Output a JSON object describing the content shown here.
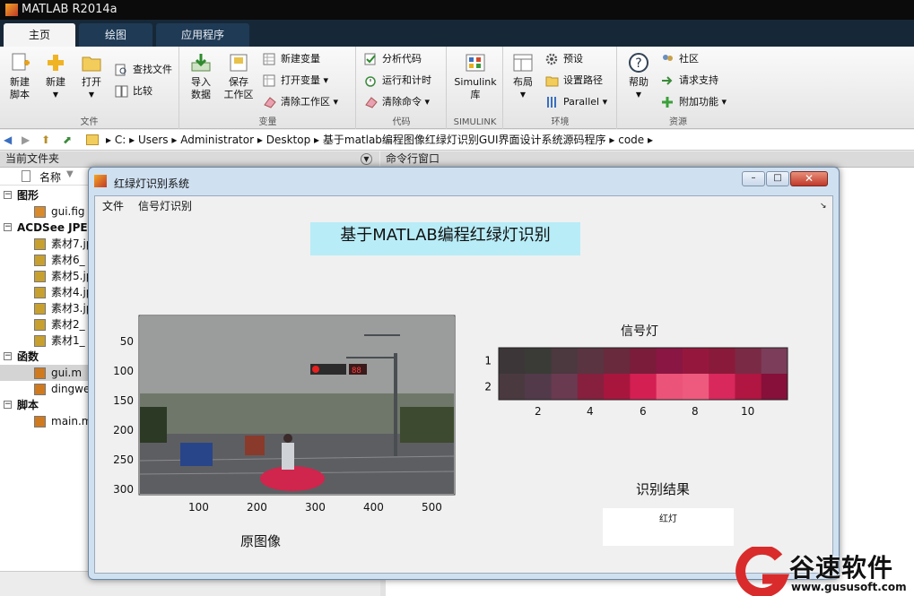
{
  "app": {
    "title": "MATLAB R2014a"
  },
  "tabs": [
    "主页",
    "绘图",
    "应用程序"
  ],
  "ribbon": {
    "file": {
      "label": "文件",
      "new_script": "新建\n脚本",
      "new": "新建",
      "open": "打开",
      "find_files": "查找文件",
      "compare": "比较"
    },
    "variable": {
      "label": "变量",
      "import": "导入\n数据",
      "save": "保存\n工作区",
      "new_var": "新建变量",
      "open_var": "打开变量",
      "clear_ws": "清除工作区"
    },
    "code": {
      "label": "代码",
      "analyze": "分析代码",
      "run_time": "运行和计时",
      "clear_cmd": "清除命令"
    },
    "simulink": {
      "label": "SIMULINK",
      "lib": "Simulink\n库"
    },
    "env": {
      "label": "环境",
      "layout": "布局",
      "prefs": "预设",
      "set_path": "设置路径",
      "parallel": "Parallel"
    },
    "resources": {
      "label": "资源",
      "help": "帮助",
      "community": "社区",
      "support": "请求支持",
      "addons": "附加功能"
    }
  },
  "address": {
    "parts": [
      "C:",
      "Users",
      "Administrator",
      "Desktop",
      "基于matlab编程图像红绿灯识别GUI界面设计系统源码程序",
      "code"
    ]
  },
  "panels": {
    "current_folder": "当前文件夹",
    "command_window": "命令行窗口",
    "name_col": "名称"
  },
  "filetree": [
    {
      "text": "图形",
      "level": 0,
      "kind": "group"
    },
    {
      "text": "gui.fig",
      "level": 1,
      "kind": "fig"
    },
    {
      "text": "ACDSee JPEG",
      "level": 0,
      "kind": "group"
    },
    {
      "text": "素材7.jp",
      "level": 1,
      "kind": "jpg"
    },
    {
      "text": "素材6_",
      "level": 1,
      "kind": "jpg"
    },
    {
      "text": "素材5.jp",
      "level": 1,
      "kind": "jpg"
    },
    {
      "text": "素材4.jp",
      "level": 1,
      "kind": "jpg"
    },
    {
      "text": "素材3.jp",
      "level": 1,
      "kind": "jpg"
    },
    {
      "text": "素材2_",
      "level": 1,
      "kind": "jpg"
    },
    {
      "text": "素材1_",
      "level": 1,
      "kind": "jpg"
    },
    {
      "text": "函数",
      "level": 0,
      "kind": "group"
    },
    {
      "text": "gui.m",
      "level": 1,
      "kind": "m",
      "selected": true
    },
    {
      "text": "dingwe",
      "level": 1,
      "kind": "m"
    },
    {
      "text": "脚本",
      "level": 0,
      "kind": "group"
    },
    {
      "text": "main.m",
      "level": 1,
      "kind": "m"
    }
  ],
  "gui": {
    "title": "红绿灯识别系统",
    "menu": [
      "文件",
      "信号灯识别"
    ],
    "heading": "基于MATLAB编程红绿灯识别",
    "image_caption": "原图像",
    "image_axes": {
      "xticks": [
        "100",
        "200",
        "300",
        "400",
        "500"
      ],
      "yticks": [
        "50",
        "100",
        "150",
        "200",
        "250",
        "300"
      ]
    },
    "signal_title": "信号灯",
    "signal_axes": {
      "xticks": [
        "2",
        "4",
        "6",
        "8",
        "10"
      ],
      "yticks": [
        "1",
        "2"
      ]
    },
    "result_title": "识别结果",
    "result_text": "红灯",
    "traffic_sign": "88"
  },
  "watermark": {
    "brand": "谷速软件",
    "url": "www.gususoft.com"
  },
  "chart_data": {
    "type": "heatmap",
    "title": "信号灯",
    "rows": [
      1,
      2
    ],
    "cols": [
      1,
      2,
      3,
      4,
      5,
      6,
      7,
      8,
      9,
      10,
      11
    ],
    "xlim": [
      0.5,
      11.5
    ],
    "ylim": [
      0.5,
      2.5
    ],
    "colors": [
      [
        "#3c3639",
        "#3a3b36",
        "#4c383f",
        "#5a3441",
        "#6a2a3d",
        "#7a1c3a",
        "#8a1643",
        "#96173d",
        "#8a1a39",
        "#7b2a45",
        "#7c3d5a"
      ],
      [
        "#4a3a40",
        "#523a4a",
        "#6a3a50",
        "#86203e",
        "#a8163e",
        "#d41f53",
        "#ec5378",
        "#ee5a7e",
        "#d8285c",
        "#b01641",
        "#86103a"
      ]
    ]
  },
  "colors": {
    "ribbon_bg": "#ececec",
    "tab_active": "#f4f4f4",
    "heading_bg": "#b8ecf7",
    "win_frame": "#cfe0f1",
    "close_btn": "#c0392b"
  }
}
